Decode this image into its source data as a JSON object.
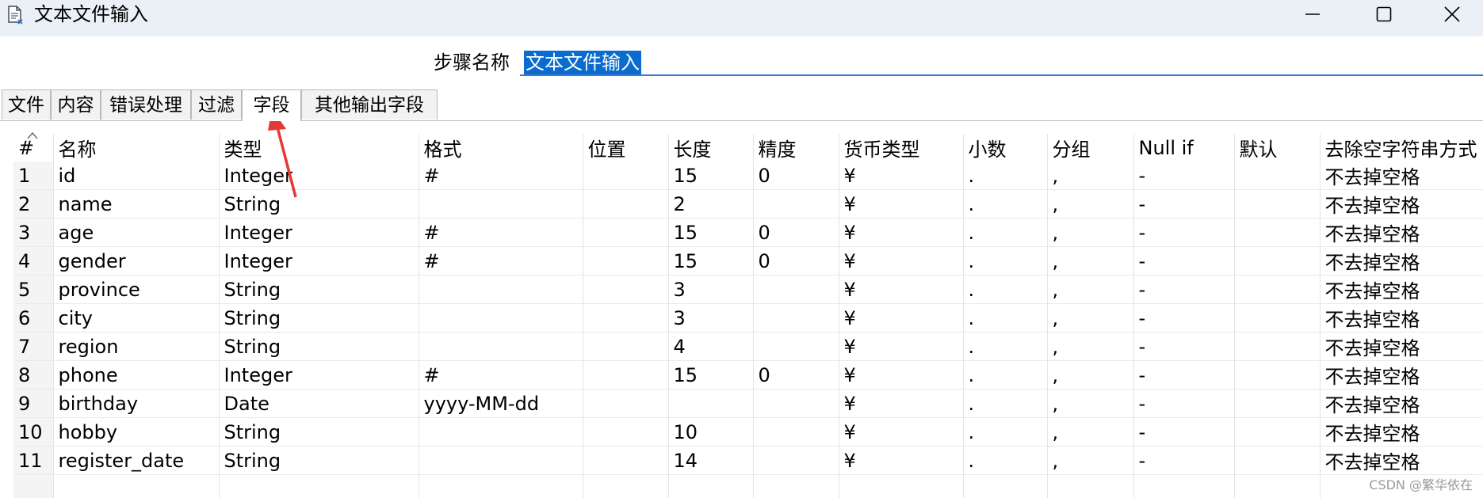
{
  "window": {
    "title": "文本文件输入",
    "controls": [
      "minimize",
      "maximize",
      "close"
    ]
  },
  "step": {
    "label": "步骤名称",
    "value": "文本文件输入"
  },
  "tabs": [
    {
      "label": "文件"
    },
    {
      "label": "内容"
    },
    {
      "label": "错误处理"
    },
    {
      "label": "过滤"
    },
    {
      "label": "字段",
      "active": true
    },
    {
      "label": "其他输出字段"
    }
  ],
  "grid": {
    "columns": [
      "#",
      "名称",
      "类型",
      "格式",
      "位置",
      "长度",
      "精度",
      "货币类型",
      "小数",
      "分组",
      "Null if",
      "默认",
      "去除空字符串方式"
    ],
    "rows": [
      [
        "1",
        "id",
        "Integer",
        "#",
        "",
        "15",
        "0",
        "¥",
        ".",
        ",",
        "-",
        "",
        "不去掉空格"
      ],
      [
        "2",
        "name",
        "String",
        "",
        "",
        "2",
        "",
        "¥",
        ".",
        ",",
        "-",
        "",
        "不去掉空格"
      ],
      [
        "3",
        "age",
        "Integer",
        "#",
        "",
        "15",
        "0",
        "¥",
        ".",
        ",",
        "-",
        "",
        "不去掉空格"
      ],
      [
        "4",
        "gender",
        "Integer",
        "#",
        "",
        "15",
        "0",
        "¥",
        ".",
        ",",
        "-",
        "",
        "不去掉空格"
      ],
      [
        "5",
        "province",
        "String",
        "",
        "",
        "3",
        "",
        "¥",
        ".",
        ",",
        "-",
        "",
        "不去掉空格"
      ],
      [
        "6",
        "city",
        "String",
        "",
        "",
        "3",
        "",
        "¥",
        ".",
        ",",
        "-",
        "",
        "不去掉空格"
      ],
      [
        "7",
        "region",
        "String",
        "",
        "",
        "4",
        "",
        "¥",
        ".",
        ",",
        "-",
        "",
        "不去掉空格"
      ],
      [
        "8",
        "phone",
        "Integer",
        "#",
        "",
        "15",
        "0",
        "¥",
        ".",
        ",",
        "-",
        "",
        "不去掉空格"
      ],
      [
        "9",
        "birthday",
        "Date",
        "yyyy-MM-dd",
        "",
        "",
        "",
        "¥",
        ".",
        ",",
        "-",
        "",
        "不去掉空格"
      ],
      [
        "10",
        "hobby",
        "String",
        "",
        "",
        "10",
        "",
        "¥",
        ".",
        ",",
        "-",
        "",
        "不去掉空格"
      ],
      [
        "11",
        "register_date",
        "String",
        "",
        "",
        "14",
        "",
        "¥",
        ".",
        ",",
        "-",
        "",
        "不去掉空格"
      ],
      [
        "",
        "",
        "",
        "",
        "",
        "",
        "",
        "",
        "",
        "",
        "",
        "",
        ""
      ]
    ]
  },
  "watermark": "CSDN @繁华依在",
  "colors": {
    "titlebar_bg": "#eaf0f6",
    "selection_bg": "#0a6cce",
    "annotation_arrow": "#e53935"
  }
}
